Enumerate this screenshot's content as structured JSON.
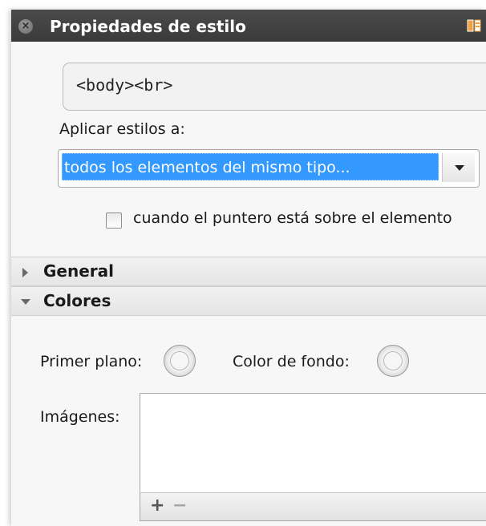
{
  "panel": {
    "title": "Propiedades de estilo",
    "close_icon": "close-circle-icon",
    "dock_icon": "dock-panel-icon"
  },
  "element": {
    "path": "<body><br>"
  },
  "apply": {
    "label": "Aplicar estilos a:",
    "selected": "todos los elementos del mismo tipo...",
    "dropdown_icon": "chevron-down-icon"
  },
  "hover_option": {
    "label": "cuando el puntero está sobre el elemento",
    "checked": false
  },
  "sections": {
    "general": {
      "label": "General",
      "expanded": false
    },
    "colores": {
      "label": "Colores",
      "expanded": true
    }
  },
  "colors": {
    "foreground_label": "Primer plano:",
    "background_label": "Color de fondo:"
  },
  "images": {
    "label": "Imágenes:",
    "add_label": "+",
    "remove_label": "−"
  },
  "theme": {
    "titlebar": "#3f3f3f",
    "selection": "#3399ff",
    "panel_bg": "#f7f7f7"
  }
}
